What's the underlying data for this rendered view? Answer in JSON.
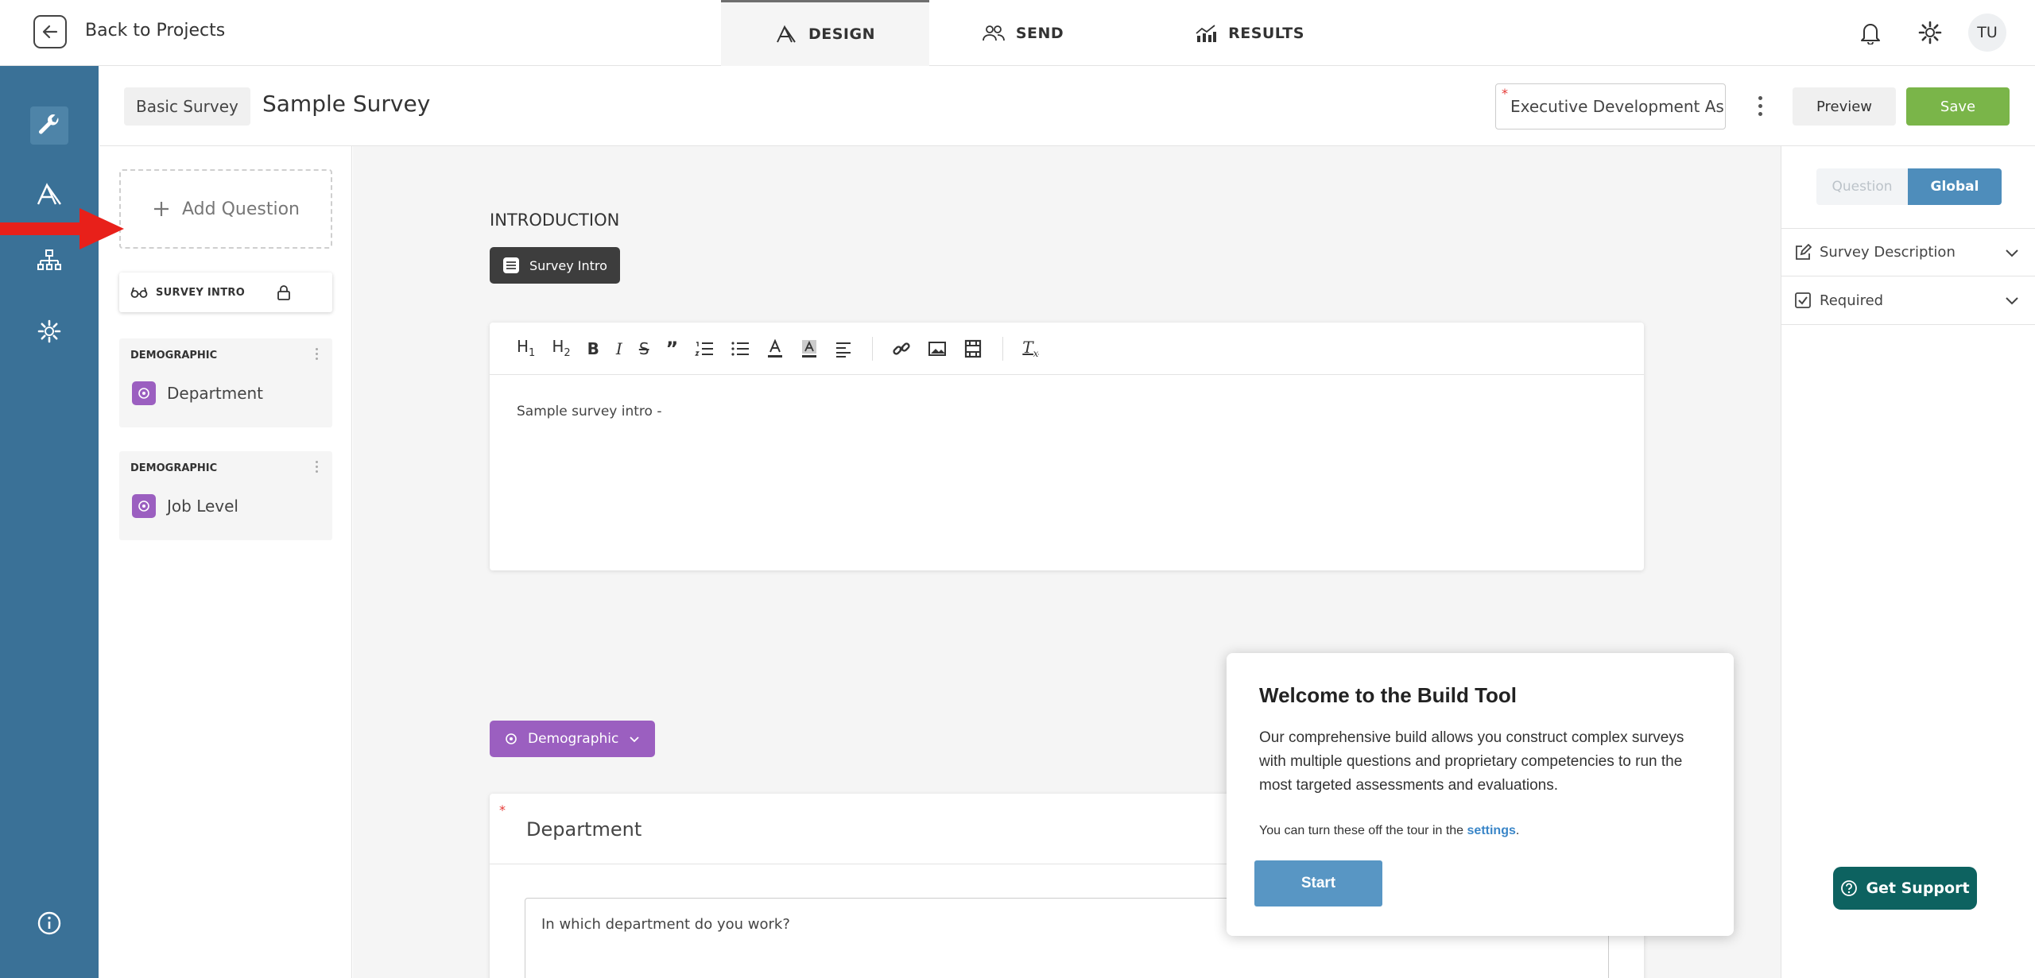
{
  "topbar": {
    "back_label": "Back to Projects",
    "tabs": [
      {
        "label": "DESIGN",
        "icon": "design-icon",
        "active": true
      },
      {
        "label": "SEND",
        "icon": "users-icon",
        "active": false
      },
      {
        "label": "RESULTS",
        "icon": "results-chart-icon",
        "active": false
      }
    ],
    "avatar_initials": "TU"
  },
  "rail": {
    "icons": [
      "wrench-icon",
      "design-icon",
      "org-tree-icon",
      "gear-icon",
      "info-icon"
    ],
    "active": "wrench-icon",
    "background": "#3a7197"
  },
  "subheader": {
    "survey_type": "Basic Survey",
    "survey_title": "Sample Survey",
    "assessment_value": "Executive Development As",
    "assessment_required_mark": "*",
    "preview_label": "Preview",
    "save_label": "Save"
  },
  "question_list": {
    "add_question_label": "Add Question",
    "intro_item_label": "SURVEY INTRO",
    "cards": [
      {
        "type": "DEMOGRAPHIC",
        "name": "Department"
      },
      {
        "type": "DEMOGRAPHIC",
        "name": "Job Level"
      }
    ]
  },
  "canvas": {
    "intro_heading": "INTRODUCTION",
    "intro_chip": "Survey Intro",
    "toolbar": [
      "H1",
      "H2",
      "B",
      "I",
      "S",
      "quote",
      "ordered-list",
      "bullet-list",
      "text-color",
      "highlight",
      "align",
      "link",
      "image",
      "video",
      "clear-format"
    ],
    "editor_text": "Sample survey intro -",
    "demographic_chip": "Demographic",
    "question": {
      "required_mark": "*",
      "title": "Department",
      "prompt": "In which department do you work?"
    }
  },
  "right_panel": {
    "seg_question": "Question",
    "seg_global": "Global",
    "rows": [
      {
        "label": "Survey Description",
        "icon": "edit-icon"
      },
      {
        "label": "Required",
        "icon": "checkbox-icon"
      }
    ],
    "support_label": "Get Support"
  },
  "tour": {
    "title": "Welcome to the Build Tool",
    "body": "Our comprehensive build allows you construct complex surveys with multiple questions and proprietary competencies to run the most targeted assessments and evaluations.",
    "note_prefix": "You can turn these off the tour in the ",
    "note_link": "settings",
    "note_suffix": ".",
    "start_label": "Start"
  },
  "colors": {
    "rail": "#3a7197",
    "save": "#7ab549",
    "global_tab": "#4e8dbb",
    "demographic": "#9b5fc0",
    "support": "#0d6260",
    "tour_start": "#5896c4",
    "arrow": "#e8201a"
  }
}
